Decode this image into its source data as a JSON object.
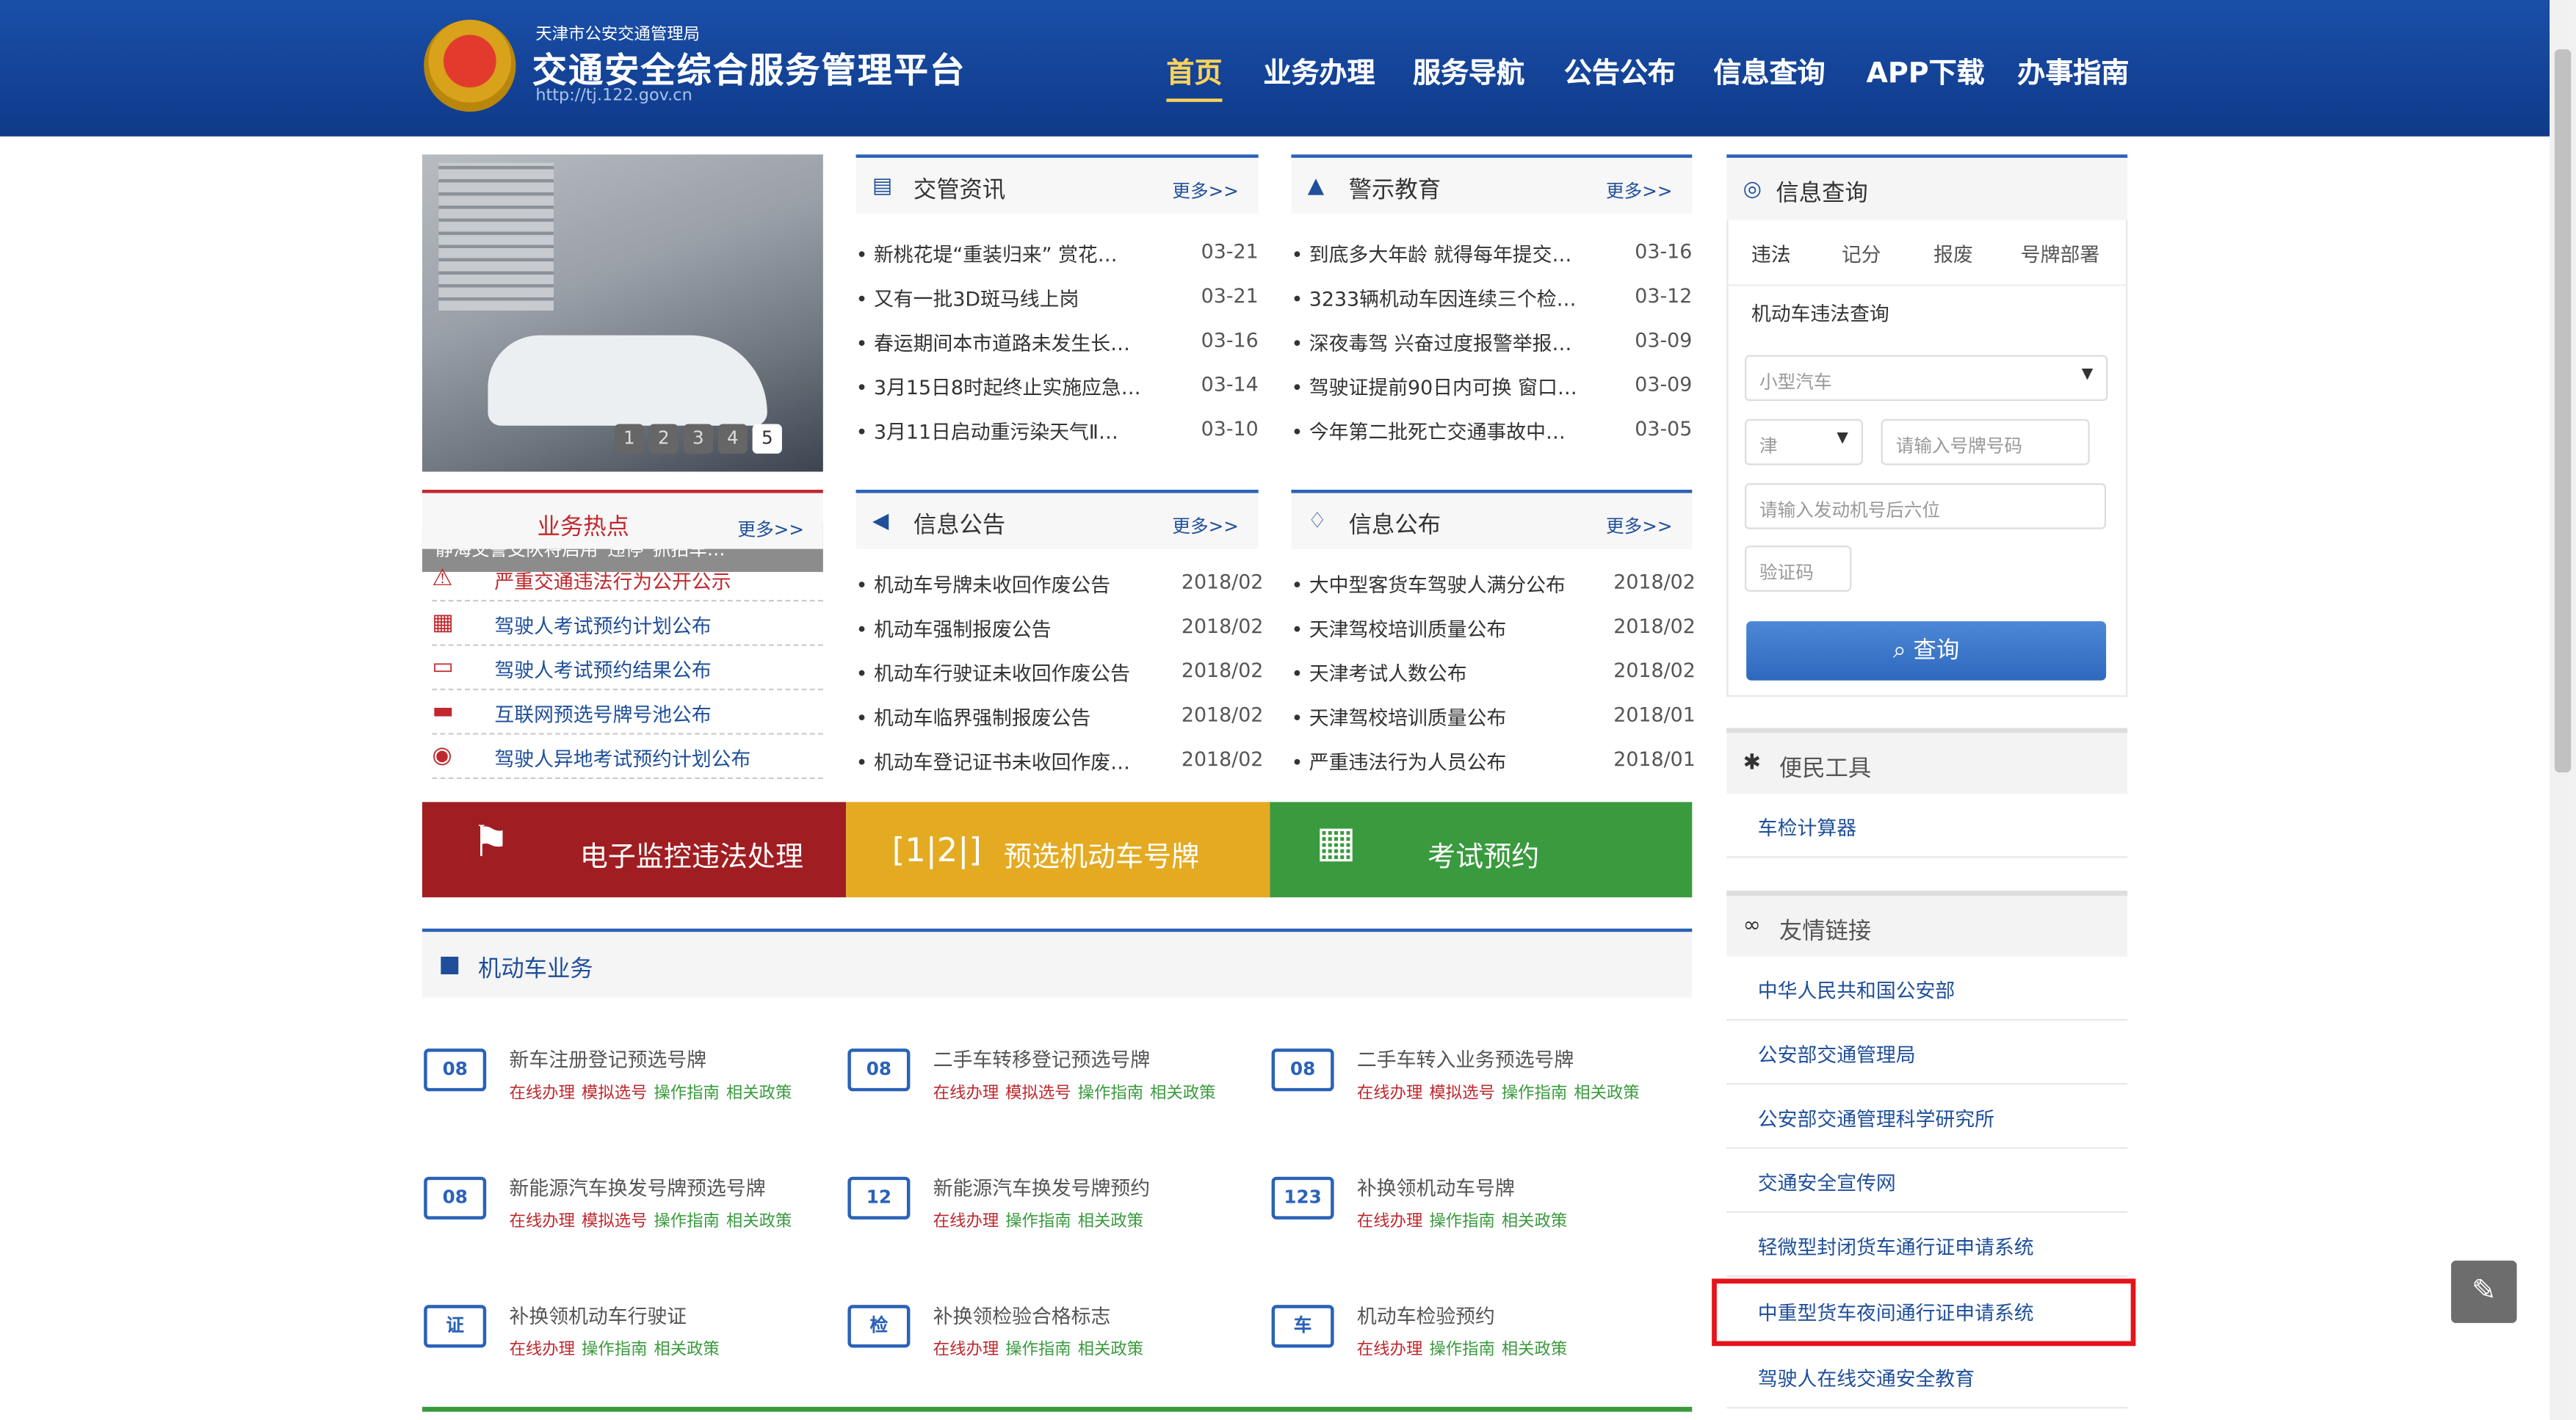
{
  "header": {
    "org": "天津市公安交通管理局",
    "title": "交通安全综合服务管理平台",
    "url": "http://tj.122.gov.cn",
    "nav": [
      "首页",
      "业务办理",
      "服务导航",
      "公告公布",
      "信息查询",
      "APP下载",
      "办事指南"
    ]
  },
  "carousel": {
    "caption": "静海交警支队将启用“违停”抓拍车…",
    "pages": [
      "1",
      "2",
      "3",
      "4",
      "5"
    ]
  },
  "panels": {
    "jgzx": {
      "title": "交管资讯",
      "more": "更多>>",
      "items": [
        {
          "t": "• 新桃花堤“重装归来” 赏花…",
          "d": "03-21"
        },
        {
          "t": "• 又有一批3D斑马线上岗",
          "d": "03-21"
        },
        {
          "t": "• 春运期间本市道路未发生长…",
          "d": "03-16"
        },
        {
          "t": "• 3月15日8时起终止实施应急…",
          "d": "03-14"
        },
        {
          "t": "• 3月11日启动重污染天气Ⅱ…",
          "d": "03-10"
        }
      ]
    },
    "jsjy": {
      "title": "警示教育",
      "more": "更多>>",
      "items": [
        {
          "t": "• 到底多大年龄 就得每年提交…",
          "d": "03-16"
        },
        {
          "t": "• 3233辆机动车因连续三个检…",
          "d": "03-12"
        },
        {
          "t": "• 深夜毒驾 兴奋过度报警举报…",
          "d": "03-09"
        },
        {
          "t": "• 驾驶证提前90日内可换 窗口…",
          "d": "03-09"
        },
        {
          "t": "• 今年第二批死亡交通事故中…",
          "d": "03-05"
        }
      ]
    },
    "xxgg": {
      "title": "信息公告",
      "more": "更多>>",
      "items": [
        {
          "t": "• 机动车号牌未收回作废公告",
          "d": "2018/02"
        },
        {
          "t": "• 机动车强制报废公告",
          "d": "2018/02"
        },
        {
          "t": "• 机动车行驶证未收回作废公告",
          "d": "2018/02"
        },
        {
          "t": "• 机动车临界强制报废公告",
          "d": "2018/02"
        },
        {
          "t": "• 机动车登记证书未收回作废…",
          "d": "2018/02"
        }
      ]
    },
    "xxgb": {
      "title": "信息公布",
      "more": "更多>>",
      "items": [
        {
          "t": "• 大中型客货车驾驶人满分公布",
          "d": "2018/02"
        },
        {
          "t": "• 天津驾校培训质量公布",
          "d": "2018/02"
        },
        {
          "t": "• 天津考试人数公布",
          "d": "2018/02"
        },
        {
          "t": "• 天津驾校培训质量公布",
          "d": "2018/01"
        },
        {
          "t": "• 严重违法行为人员公布",
          "d": "2018/01"
        }
      ]
    }
  },
  "hot": {
    "title": "业务热点",
    "more": "更多>>",
    "items": [
      "严重交通违法行为公开公示",
      "驾驶人考试预约计划公布",
      "驾驶人考试预约结果公布",
      "互联网预选号牌号池公布",
      "驾驶人异地考试预约计划公布"
    ]
  },
  "bigbtns": [
    {
      "label": "电子监控违法处理",
      "color": "#a01e22"
    },
    {
      "label": "预选机动车号牌",
      "color": "#e4ab22"
    },
    {
      "label": "考试预约",
      "color": "#3a9a3e"
    }
  ],
  "vehicle": {
    "title": "机动车业务",
    "items": [
      {
        "name": "新车注册登记预选号牌",
        "links": [
          "在线办理",
          "模拟选号",
          "操作指南",
          "相关政策"
        ],
        "icon": "08"
      },
      {
        "name": "二手车转移登记预选号牌",
        "links": [
          "在线办理",
          "模拟选号",
          "操作指南",
          "相关政策"
        ],
        "icon": "08"
      },
      {
        "name": "二手车转入业务预选号牌",
        "links": [
          "在线办理",
          "模拟选号",
          "操作指南",
          "相关政策"
        ],
        "icon": "08"
      },
      {
        "name": "新能源汽车换发号牌预选号牌",
        "links": [
          "在线办理",
          "模拟选号",
          "操作指南",
          "相关政策"
        ],
        "icon": "08"
      },
      {
        "name": "新能源汽车换发号牌预约",
        "links": [
          "在线办理",
          "操作指南",
          "相关政策"
        ],
        "icon": "12"
      },
      {
        "name": "补换领机动车号牌",
        "links": [
          "在线办理",
          "操作指南",
          "相关政策"
        ],
        "icon": "123"
      },
      {
        "name": "补换领机动车行驶证",
        "links": [
          "在线办理",
          "操作指南",
          "相关政策"
        ],
        "icon": "证"
      },
      {
        "name": "补换领检验合格标志",
        "links": [
          "在线办理",
          "操作指南",
          "相关政策"
        ],
        "icon": "检"
      },
      {
        "name": "机动车检验预约",
        "links": [
          "在线办理",
          "操作指南",
          "相关政策"
        ],
        "icon": "车"
      }
    ]
  },
  "query": {
    "title": "信息查询",
    "tabs": [
      "违法",
      "记分",
      "报废",
      "号牌部署"
    ],
    "label": "机动车违法查询",
    "car_type": "小型汽车",
    "province": "津",
    "plate_placeholder": "请输入号牌号码",
    "engine_placeholder": "请输入发动机号后六位",
    "captcha_placeholder": "验证码",
    "button": "查询"
  },
  "tools": {
    "title": "便民工具",
    "items": [
      "车检计算器"
    ]
  },
  "links": {
    "title": "友情链接",
    "items": [
      "中华人民共和国公安部",
      "公安部交通管理局",
      "公安部交通管理科学研究所",
      "交通安全宣传网",
      "轻微型封闭货车通行证申请系统",
      "中重型货车夜间通行证申请系统",
      "驾驶人在线交通安全教育"
    ]
  }
}
